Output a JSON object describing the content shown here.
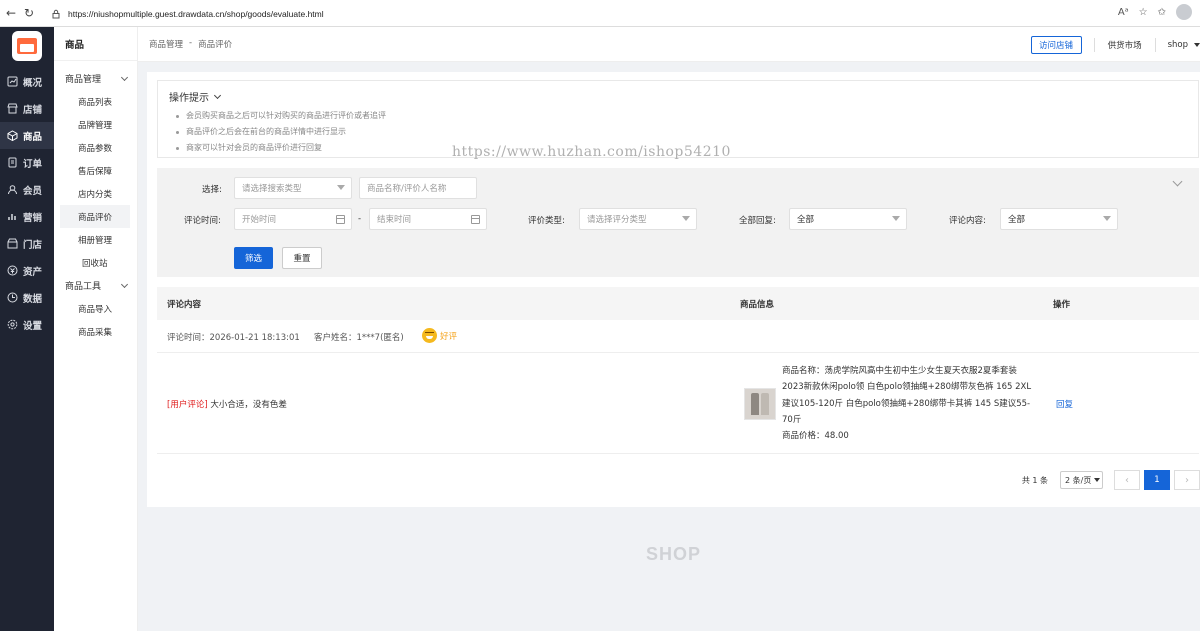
{
  "browser": {
    "url": "https://niushopmultiple.guest.drawdata.cn/shop/goods/evaluate.html"
  },
  "sidebar": {
    "items": [
      {
        "label": "概况",
        "icon": "dashboard-icon"
      },
      {
        "label": "店铺",
        "icon": "store-icon"
      },
      {
        "label": "商品",
        "icon": "goods-icon",
        "active": true
      },
      {
        "label": "订单",
        "icon": "order-icon"
      },
      {
        "label": "会员",
        "icon": "member-icon"
      },
      {
        "label": "营销",
        "icon": "marketing-icon"
      },
      {
        "label": "门店",
        "icon": "shop-icon"
      },
      {
        "label": "资产",
        "icon": "asset-icon"
      },
      {
        "label": "数据",
        "icon": "data-icon"
      },
      {
        "label": "设置",
        "icon": "settings-icon"
      }
    ]
  },
  "subnav": {
    "title": "商品",
    "group1": "商品管理",
    "items1": [
      "商品列表",
      "品牌管理",
      "商品参数",
      "售后保障",
      "店内分类",
      "商品评价",
      "相册管理",
      "回收站"
    ],
    "group2": "商品工具",
    "items2": [
      "商品导入",
      "商品采集"
    ]
  },
  "header": {
    "crumb_1": "商品管理",
    "crumb_sep": "-",
    "crumb_2": "商品评价",
    "visit_store": "访问店铺",
    "supply_market": "供货市场",
    "shop_user": "shop"
  },
  "tips": {
    "title": "操作提示",
    "lines": [
      "会员购买商品之后可以针对购买的商品进行评价或者追评",
      "商品评价之后会在前台的商品详情中进行显示",
      "商家可以针对会员的商品评价进行回复"
    ]
  },
  "watermark": "https://www.huzhan.com/ishop54210",
  "filter": {
    "select_label": "选择:",
    "search_type_placeholder": "请选择搜索类型",
    "keyword_placeholder": "商品名称/评价人名称",
    "time_label": "评论时间:",
    "start_placeholder": "开始时间",
    "range_sep": "-",
    "end_placeholder": "结束时间",
    "type_label": "评价类型:",
    "type_placeholder": "请选择评分类型",
    "reply_label": "全部回复:",
    "reply_value": "全部",
    "content_label": "评论内容:",
    "content_value": "全部",
    "search_btn": "筛选",
    "reset_btn": "重置"
  },
  "table": {
    "col_review": "评论内容",
    "col_goods": "商品信息",
    "col_action": "操作",
    "row": {
      "time": "评论时间：2026-01-21 18:13:01",
      "customer": "客户姓名：1***7(匿名)",
      "rating": "好评",
      "tag": "[用户评论]",
      "content": "大小合适，没有色差",
      "goods_name_1": "商品名称：荡虎学院风高中生初中生少女生夏天衣服2夏季套装",
      "goods_name_2": "2023新款休闲polo领 白色polo领抽绳+280绑带灰色裤 165 2XL",
      "goods_name_3": "建议105-120斤 白色polo领抽绳+280绑带卡其裤 145 S建议55-",
      "goods_name_4": "70斤",
      "goods_price": "商品价格：48.00",
      "action": "回复"
    }
  },
  "pager": {
    "total": "共 1 条",
    "size": "2 条/页",
    "page": "1",
    "prev": "‹",
    "next": "›"
  },
  "footer_logo": "SHOP",
  "colors": {
    "primary": "#1565d8",
    "sidebar_bg": "#1f2432",
    "tag_red": "#e02020",
    "rating_yellow": "#f5a623"
  }
}
